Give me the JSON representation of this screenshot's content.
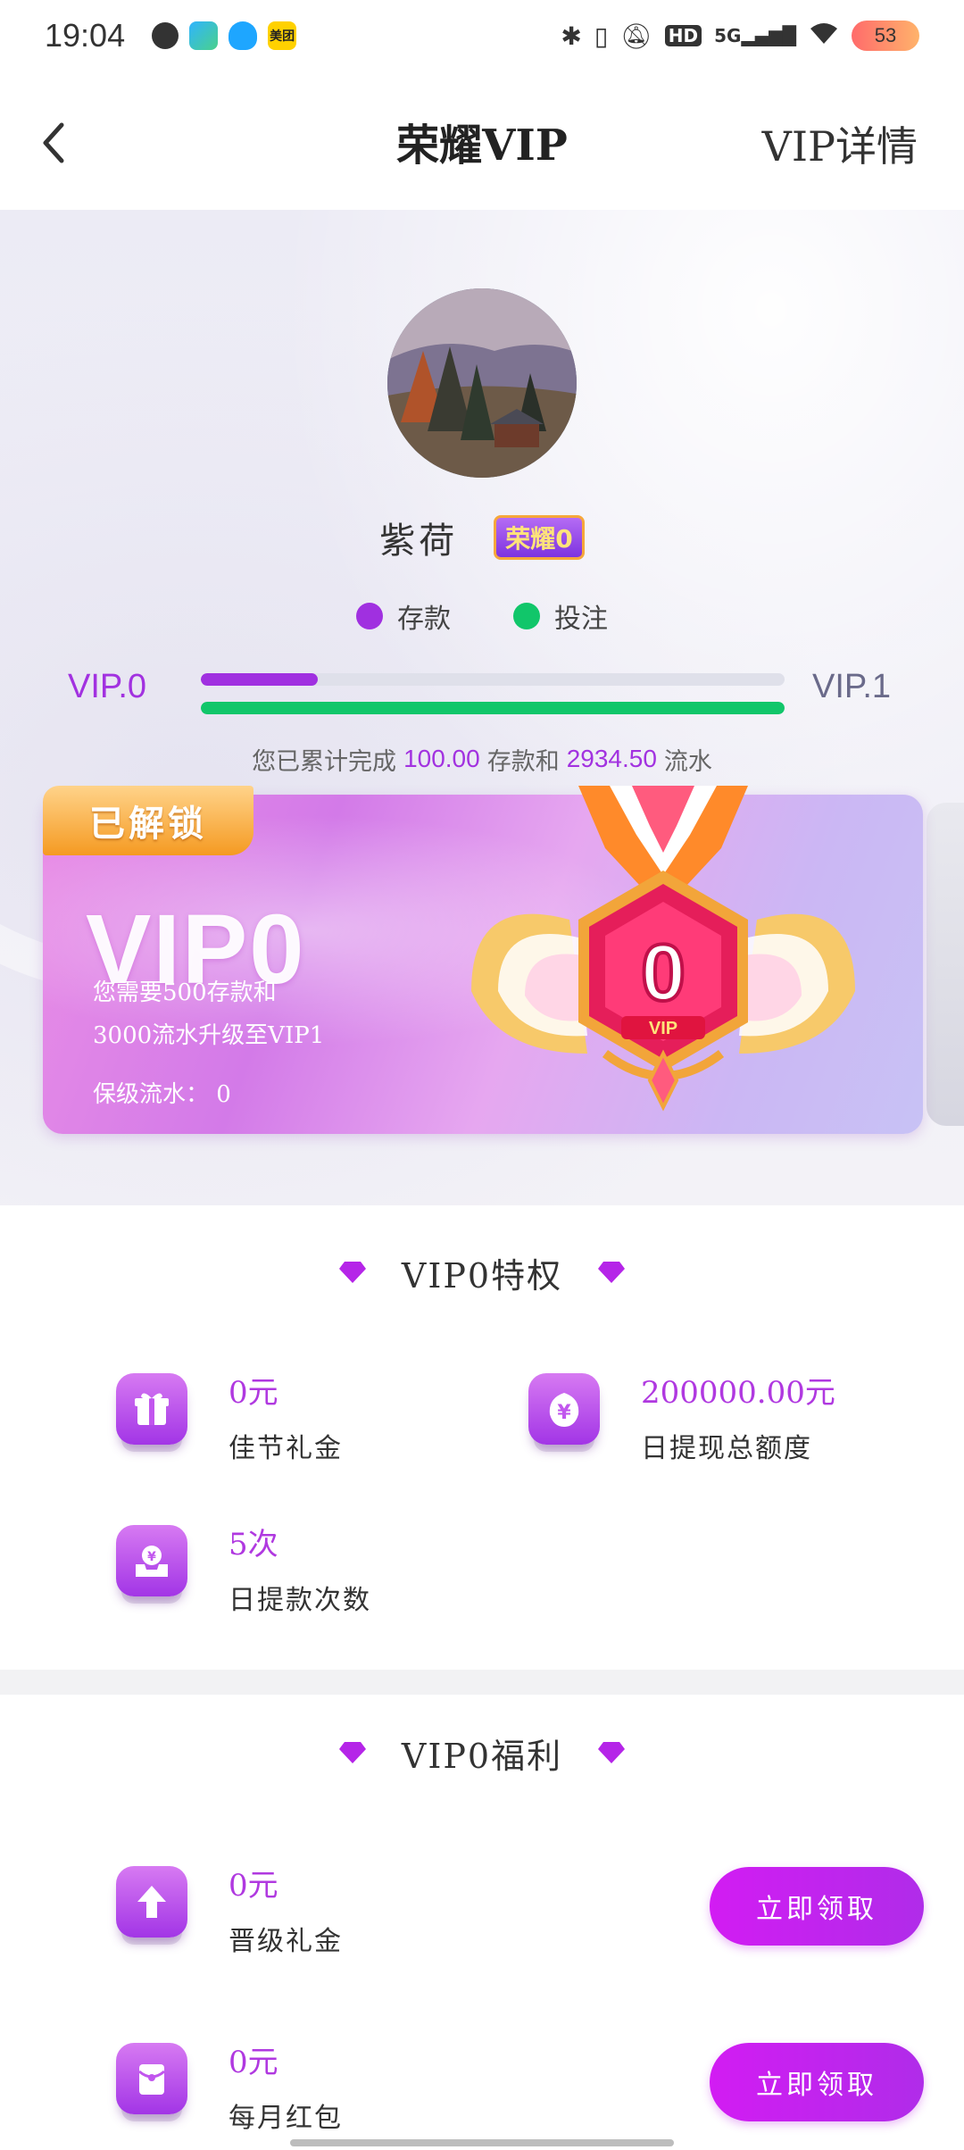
{
  "status_bar": {
    "time": "19:04",
    "app_icons": [
      "nfc-icon",
      "radar-app-icon",
      "qq-icon",
      "meituan-icon"
    ],
    "meituan_text": "美团",
    "right_icons": [
      "bluetooth-icon",
      "vibrate-icon",
      "mute-icon",
      "hd-icon",
      "5g-signal-icon",
      "wifi-icon"
    ],
    "hd_text": "HD",
    "network_text": "5G",
    "battery": "53"
  },
  "header": {
    "back_icon": "chevron-left-icon",
    "title": "荣耀VIP",
    "right_link": "VIP详情"
  },
  "profile": {
    "username": "紫荷",
    "level_badge": "荣耀0"
  },
  "legend": [
    {
      "label": "存款",
      "color": "#a030e0"
    },
    {
      "label": "投注",
      "color": "#11c66a"
    }
  ],
  "progress": {
    "current_level": "VIP.0",
    "next_level": "VIP.1",
    "deposit_fraction": 0.2,
    "bet_fraction": 1.0
  },
  "summary": {
    "prefix": "您已累计完成",
    "deposit_amount": "100.00",
    "middle": "存款和",
    "turnover_amount": "2934.50",
    "suffix": "流水"
  },
  "vip_card": {
    "unlock_tag": "已解锁",
    "title": "VIP0",
    "requirement_line1": "您需要500存款和",
    "requirement_line2": "3000流水升级至VIP1",
    "keep_level": "保级流水： 0",
    "medal_number": "0",
    "medal_text": "VIP"
  },
  "privileges": {
    "title": "VIP0特权",
    "items": [
      {
        "value": "0元",
        "label": "佳节礼金",
        "icon": "gift-icon"
      },
      {
        "value": "200000.00元",
        "label": "日提现总额度",
        "icon": "yen-bag-icon"
      },
      {
        "value": "5次",
        "label": "日提款次数",
        "icon": "withdraw-tray-icon"
      }
    ]
  },
  "welfare": {
    "title": "VIP0福利",
    "items": [
      {
        "value": "0元",
        "label": "晋级礼金",
        "icon": "upgrade-arrow-icon",
        "button": "立即领取"
      },
      {
        "value": "0元",
        "label": "每月红包",
        "icon": "red-envelope-icon",
        "button": "立即领取"
      }
    ]
  },
  "colors": {
    "accent": "#b039e0",
    "deposit_bar": "#a030e0",
    "bet_bar": "#11c66a",
    "button": "#c822ee"
  }
}
